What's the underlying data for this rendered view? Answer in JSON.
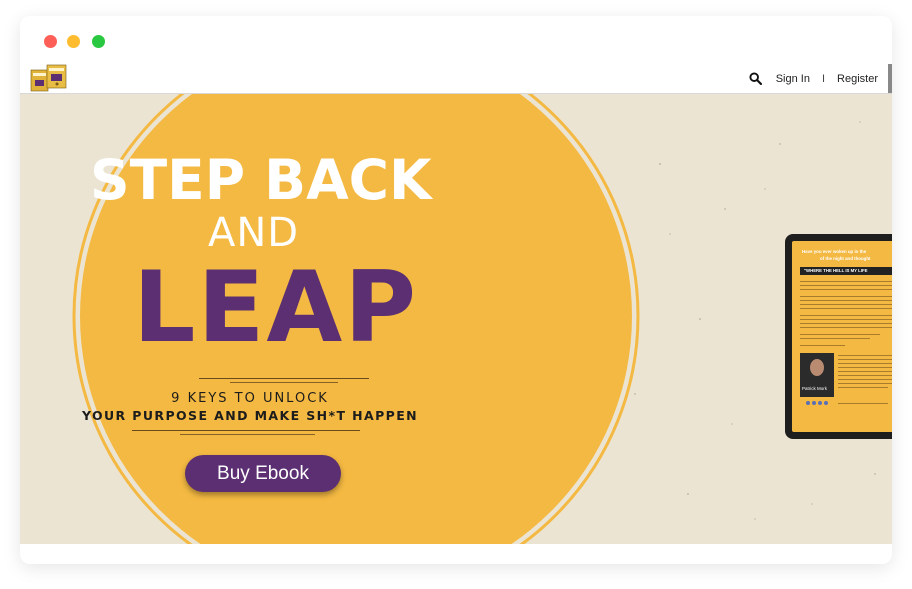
{
  "window": {
    "controls": [
      "close",
      "minimize",
      "maximize"
    ]
  },
  "navbar": {
    "logo_icon": "book-covers-logo",
    "search_icon": "search-icon",
    "sign_in": "Sign In",
    "separator": "I",
    "register": "Register"
  },
  "hero": {
    "title_line1": "STEP BACK",
    "title_line2": "AND",
    "title_line3": "LEAP",
    "subtitle_line1": "9 KEYS TO UNLOCK",
    "subtitle_line2": "YOUR PURPOSE AND MAKE SH*T HAPPEN",
    "cta_label": "Buy Ebook",
    "colors": {
      "accent_yellow": "#f4b942",
      "brand_purple": "#5b2f72",
      "background_paper": "#ece4d2"
    }
  },
  "tablet_preview": {
    "heading_line1": "Have you ever woken up in the",
    "heading_line2": "of the night and thought",
    "banner": "\"WHERE THE HELL IS MY LIFE",
    "author_name": "Patrick Mork"
  }
}
